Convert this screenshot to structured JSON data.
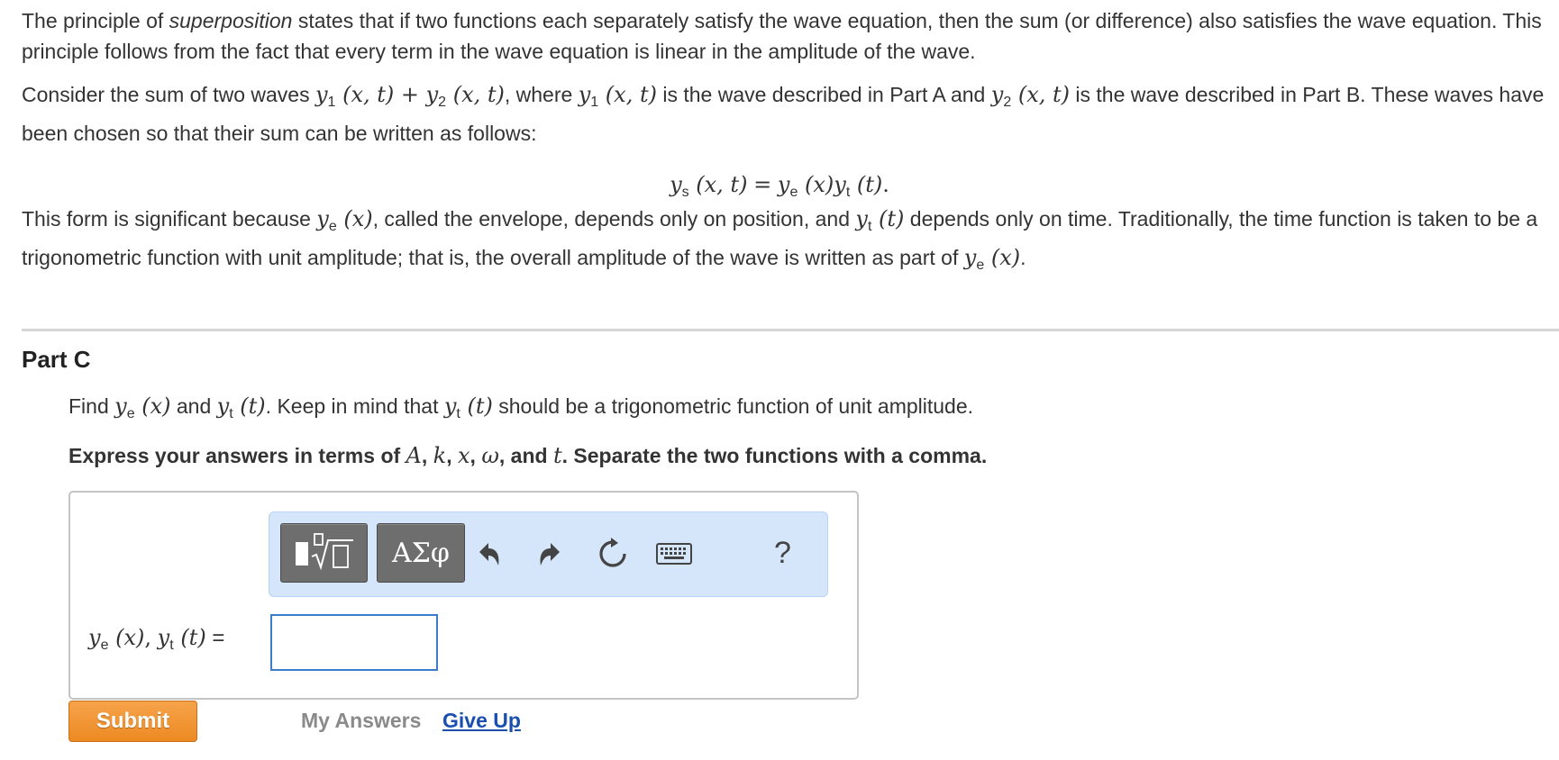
{
  "intro": {
    "p1_a": "The principle of ",
    "p1_em": "superposition",
    "p1_b": " states that if two functions each separately satisfy the wave equation, then the sum (or difference) also satisfies the wave equation. This principle follows from the fact that every term in the wave equation is linear in the amplitude of the wave.",
    "p2_a": "Consider the sum of two waves ",
    "p2_b": ", where ",
    "p2_c": " is the wave described in Part A and ",
    "p2_d": " is the wave described in Part B. These waves have been chosen so that their sum can be written as follows:",
    "p3_a": "This form is significant because ",
    "p3_b": ", called the envelope, depends only on position, and ",
    "p3_c": " depends only on time. Traditionally, the time function is taken to be a trigonometric function with unit amplitude; that is, the overall amplitude of the wave is written as part of ",
    "p3_d": "."
  },
  "part": {
    "title": "Part C",
    "q_a": "Find ",
    "q_b": " and ",
    "q_c": ". Keep in mind that ",
    "q_d": " should be a trigonometric function of unit amplitude.",
    "express_a": "Express your answers in terms of ",
    "express_b": ", and ",
    "express_c": ". Separate the two functions with a comma.",
    "var_A": "A",
    "var_k": "k",
    "var_x": "x",
    "var_w": "ω",
    "var_t": "t",
    "comma": ", "
  },
  "toolbar": {
    "symbols_label": "ΑΣφ",
    "help_label": "?"
  },
  "answer": {
    "equals": " ="
  },
  "actions": {
    "submit": "Submit",
    "my_answers": "My Answers",
    "give_up": "Give Up"
  }
}
